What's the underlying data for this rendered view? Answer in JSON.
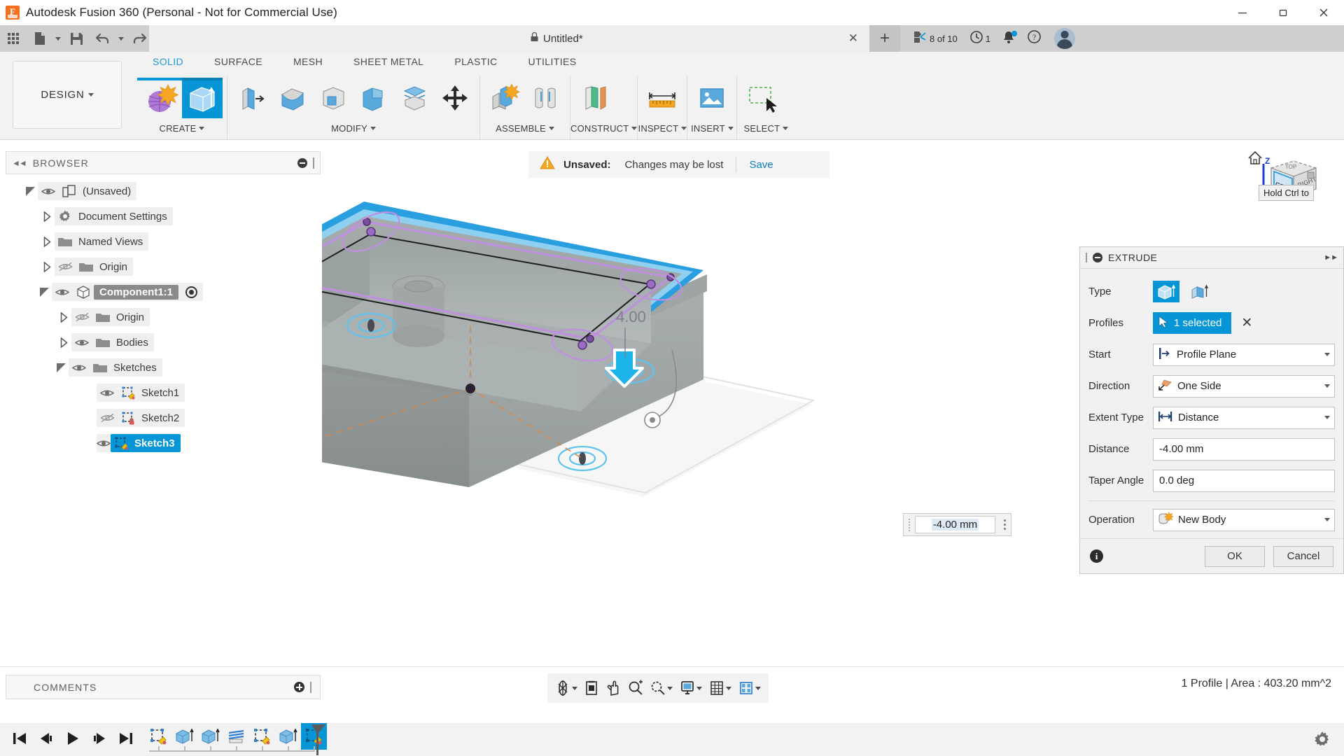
{
  "window": {
    "title": "Autodesk Fusion 360 (Personal - Not for Commercial Use)",
    "app_icon": "fusion360-logo-icon",
    "minimize": "minimize-icon",
    "maximize": "restore-icon",
    "close": "close-icon"
  },
  "quick_access": {
    "items": [
      {
        "name": "app-grid-icon",
        "label": ""
      },
      {
        "name": "new-file-icon",
        "label": ""
      },
      {
        "name": "save-icon",
        "label": ""
      },
      {
        "name": "undo-icon",
        "label": ""
      },
      {
        "name": "redo-icon",
        "label": ""
      }
    ]
  },
  "document_tab": {
    "title": "Untitled*",
    "lock_icon": "lock-icon",
    "close_label": "✕",
    "new_tab_label": "+"
  },
  "tab_right": {
    "extension_count": "8 of 10",
    "job_count": "1",
    "extension_icon": "extension-manager-icon",
    "jobs_icon": "job-status-clock-icon",
    "notification_icon": "notification-bell-icon",
    "help_icon": "help-question-icon",
    "avatar_icon": "user-avatar"
  },
  "ribbon": {
    "workspace": "DESIGN",
    "tabs": [
      {
        "label": "SOLID",
        "active": true
      },
      {
        "label": "SURFACE",
        "active": false
      },
      {
        "label": "MESH",
        "active": false
      },
      {
        "label": "SHEET METAL",
        "active": false
      },
      {
        "label": "PLASTIC",
        "active": false
      },
      {
        "label": "UTILITIES",
        "active": false
      }
    ],
    "panels": [
      {
        "label": "CREATE",
        "has_dropdown": true,
        "tools": [
          {
            "name": "create-sketch-icon",
            "selected": false
          },
          {
            "name": "extrude-icon",
            "selected": true
          }
        ]
      },
      {
        "label": "MODIFY",
        "has_dropdown": true,
        "tools": [
          {
            "name": "press-pull-icon",
            "selected": false
          },
          {
            "name": "fillet-icon",
            "selected": false
          },
          {
            "name": "shell-icon",
            "selected": false
          },
          {
            "name": "combine-icon",
            "selected": false
          },
          {
            "name": "split-face-icon",
            "selected": false
          },
          {
            "name": "move-copy-icon",
            "selected": false
          }
        ]
      },
      {
        "label": "ASSEMBLE",
        "has_dropdown": true,
        "tools": [
          {
            "name": "new-component-icon",
            "selected": false
          },
          {
            "name": "joint-icon",
            "selected": false
          }
        ]
      },
      {
        "label": "CONSTRUCT",
        "has_dropdown": true,
        "tools": [
          {
            "name": "offset-plane-icon",
            "selected": false
          }
        ]
      },
      {
        "label": "INSPECT",
        "has_dropdown": true,
        "tools": [
          {
            "name": "measure-icon",
            "selected": false
          }
        ]
      },
      {
        "label": "INSERT",
        "has_dropdown": true,
        "tools": [
          {
            "name": "insert-canvas-icon",
            "selected": false
          }
        ]
      },
      {
        "label": "SELECT",
        "has_dropdown": true,
        "tools": [
          {
            "name": "selection-filter-icon",
            "selected": false
          }
        ]
      }
    ]
  },
  "browser": {
    "header": "BROWSER",
    "collapse_icon": "collapse-left-icon",
    "minimize_icon": "minus-circle-icon",
    "grip_icon": "resize-grip-icon",
    "nodes": [
      {
        "label": "(Unsaved)",
        "indent": 0,
        "expander": "down",
        "visible": true,
        "icon": "document-icon",
        "selected": false
      },
      {
        "label": "Document Settings",
        "indent": 1,
        "expander": "right",
        "visible": null,
        "icon": "gear-icon",
        "selected": false
      },
      {
        "label": "Named Views",
        "indent": 1,
        "expander": "right",
        "visible": null,
        "icon": "folder-icon",
        "selected": false
      },
      {
        "label": "Origin",
        "indent": 1,
        "expander": "right",
        "visible": false,
        "icon": "folder-icon",
        "selected": false
      },
      {
        "label": "Component1:1",
        "indent": 1,
        "expander": "down",
        "visible": true,
        "icon": "component-icon",
        "selected": true,
        "activate_icon": "activate-target-icon"
      },
      {
        "label": "Origin",
        "indent": 2,
        "expander": "right",
        "visible": false,
        "icon": "folder-icon",
        "selected": false
      },
      {
        "label": "Bodies",
        "indent": 2,
        "expander": "right",
        "visible": true,
        "icon": "folder-icon",
        "selected": false
      },
      {
        "label": "Sketches",
        "indent": 2,
        "expander": "down",
        "visible": true,
        "icon": "folder-icon",
        "selected": false
      },
      {
        "label": "Sketch1",
        "indent": 3,
        "expander": "none",
        "visible": true,
        "icon": "sketch-icon",
        "selected": false
      },
      {
        "label": "Sketch2",
        "indent": 3,
        "expander": "none",
        "visible": false,
        "icon": "sketch-locked-icon",
        "selected": false
      },
      {
        "label": "Sketch3",
        "indent": 3,
        "expander": "none",
        "visible": true,
        "icon": "sketch-icon",
        "selected": "highlight"
      }
    ]
  },
  "unsaved_bar": {
    "warning_icon": "warning-triangle-icon",
    "label": "Unsaved:",
    "message": "Changes may be lost",
    "action": "Save"
  },
  "viewcube": {
    "home_icon": "home-house-icon",
    "front_face": "FRONT",
    "top_face": "TOP",
    "axis_z": "Z",
    "tooltip": "Hold Ctrl to"
  },
  "extrude_dialog": {
    "title": "EXTRUDE",
    "collapse_icon": "minus-circle-icon",
    "expand_icon": "expand-right-icon",
    "rows": [
      {
        "label": "Type",
        "kind": "typebuttons",
        "options": [
          "extrude-solid-icon",
          "extrude-thin-icon"
        ],
        "selected_index": 0
      },
      {
        "label": "Profiles",
        "kind": "selection",
        "value": "1 selected",
        "cursor_icon": "cursor-arrow-icon",
        "clear_icon": "clear-x-icon"
      },
      {
        "label": "Start",
        "kind": "combo",
        "value": "Profile Plane",
        "icon": "profile-plane-icon"
      },
      {
        "label": "Direction",
        "kind": "combo",
        "value": "One Side",
        "icon": "one-side-arrow-icon"
      },
      {
        "label": "Extent Type",
        "kind": "combo",
        "value": "Distance",
        "icon": "distance-arrows-icon"
      },
      {
        "label": "Distance",
        "kind": "field",
        "value": "-4.00 mm"
      },
      {
        "label": "Taper Angle",
        "kind": "field",
        "value": "0.0 deg"
      },
      {
        "label": "Operation",
        "kind": "combo",
        "value": "New Body",
        "icon": "new-body-icon"
      }
    ],
    "info_icon": "info-circle-icon",
    "ok_label": "OK",
    "cancel_label": "Cancel"
  },
  "canvas": {
    "distance_value": "-4.00 mm",
    "dimension_label": "4.00",
    "drag_handle_icon": "down-arrow-handle-icon",
    "manipulator_kebab_icon": "more-options-icon",
    "manipulator_grip_icon": "drag-grip-icon"
  },
  "navbar": {
    "items": [
      {
        "name": "orbit-icon",
        "caret": true
      },
      {
        "name": "look-at-icon",
        "caret": false
      },
      {
        "name": "pan-icon",
        "caret": false
      },
      {
        "name": "zoom-icon",
        "caret": false
      },
      {
        "name": "zoom-window-icon",
        "caret": true
      },
      {
        "name": "display-settings-icon",
        "caret": true
      },
      {
        "name": "grid-snaps-icon",
        "caret": true
      },
      {
        "name": "viewports-icon",
        "caret": true
      }
    ]
  },
  "status_bar": {
    "text": "1 Profile | Area : 403.20 mm^2"
  },
  "comments": {
    "header": "COMMENTS",
    "add_icon": "plus-circle-icon",
    "grip_icon": "resize-grip-icon"
  },
  "timeline": {
    "playback": [
      {
        "name": "go-to-beginning-icon"
      },
      {
        "name": "step-back-icon"
      },
      {
        "name": "play-icon"
      },
      {
        "name": "step-forward-icon"
      },
      {
        "name": "go-to-end-icon"
      }
    ],
    "features": [
      {
        "name": "timeline-sketch-1",
        "icon": "sketch-icon",
        "current": false
      },
      {
        "name": "timeline-extrude-1",
        "icon": "extrude-icon",
        "current": false
      },
      {
        "name": "timeline-extrude-2",
        "icon": "extrude-icon",
        "current": false
      },
      {
        "name": "timeline-shell-1",
        "icon": "shell-icon",
        "current": false
      },
      {
        "name": "timeline-sketch-2",
        "icon": "sketch-icon",
        "current": false
      },
      {
        "name": "timeline-extrude-3",
        "icon": "extrude-icon",
        "current": false
      },
      {
        "name": "timeline-sketch-3",
        "icon": "sketch-icon",
        "current": true
      }
    ],
    "settings_icon": "gear-icon"
  },
  "colors": {
    "accent_blue": "#0696d7",
    "selection_blue": "#2a9fe0",
    "sketch_purple": "#c08fe0",
    "warning_orange": "#f0a500",
    "brand_orange": "#f37021",
    "model_gray": "#9aa0a0"
  }
}
